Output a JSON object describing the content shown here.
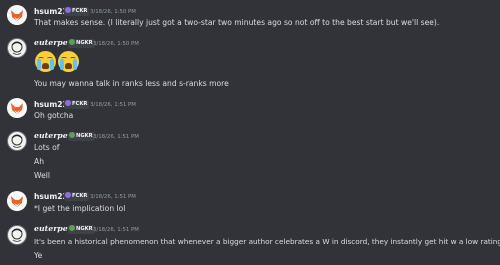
{
  "messages": [
    {
      "author": "hsum23",
      "tag": "FCKR",
      "time": "3/18/26, 1:50 PM",
      "lines": [
        "That makes sense. (I literally just got a two-star two minutes ago so not off to the best start but we'll see)."
      ]
    },
    {
      "author": "euterpe",
      "tag": "NGKR",
      "time": "3/18/26, 1:50 PM",
      "emojis": [
        "loudly-crying-face",
        "loudly-crying-face"
      ],
      "lines": [
        "You may wanna talk in ranks less and s-ranks more"
      ]
    },
    {
      "author": "hsum23",
      "tag": "FCKR",
      "time": "3/18/26, 1:51 PM",
      "lines": [
        "Oh gotcha"
      ]
    },
    {
      "author": "euterpe",
      "tag": "NGKR",
      "time": "3/18/26, 1:51 PM",
      "lines": [
        "Lots of",
        "Ah",
        "Well"
      ]
    },
    {
      "author": "hsum23",
      "tag": "FCKR",
      "time": "3/18/26, 1:51 PM",
      "lines": [
        "*I get the implication lol"
      ]
    },
    {
      "author": "euterpe",
      "tag": "NGKR",
      "time": "3/18/26, 1:51 PM",
      "lines": [
        "It's been a historical phenomenon that whenever a bigger author celebrates a W in discord, they instantly get hit w a low rating lol",
        "Ye"
      ]
    }
  ]
}
